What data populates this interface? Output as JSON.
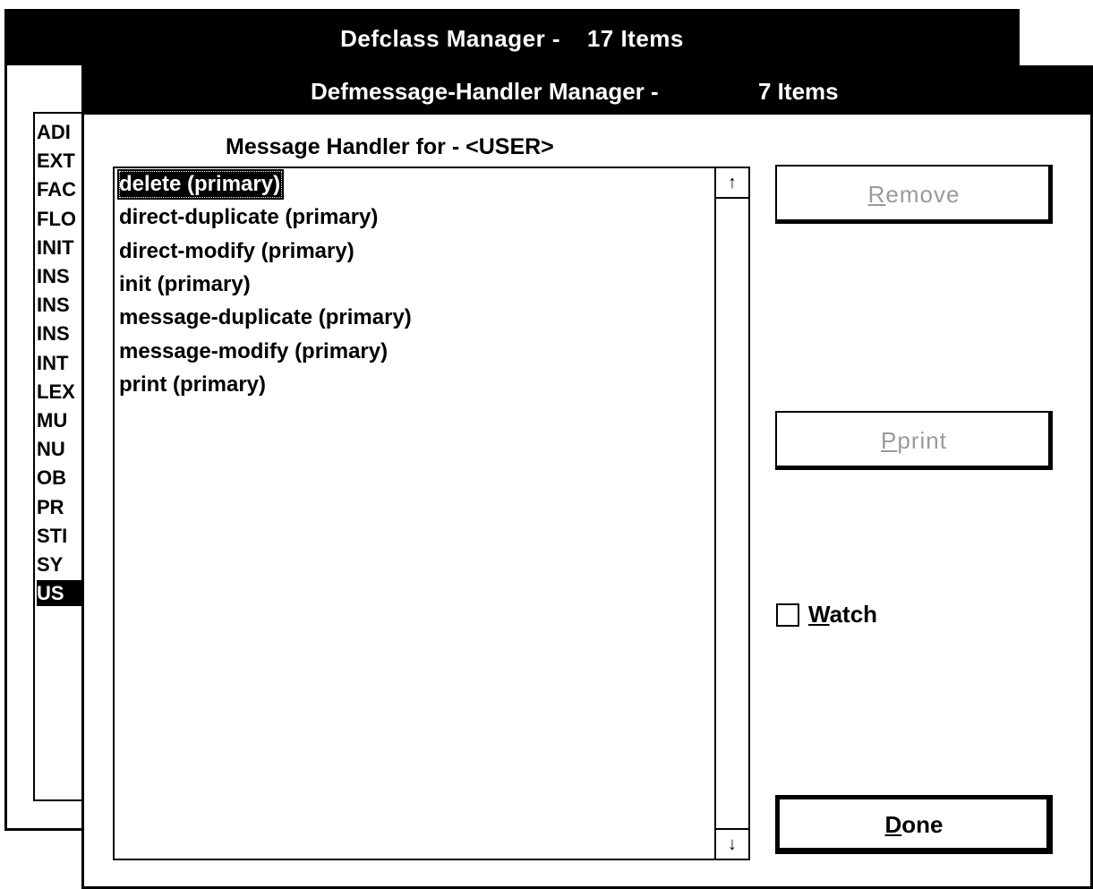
{
  "back_window": {
    "title": "Defclass Manager -",
    "count": "17 Items",
    "items": [
      {
        "label": "ADI",
        "selected": false
      },
      {
        "label": "EXT",
        "selected": false
      },
      {
        "label": "FAC",
        "selected": false
      },
      {
        "label": "FLO",
        "selected": false
      },
      {
        "label": "INIT",
        "selected": false
      },
      {
        "label": "INS",
        "selected": false
      },
      {
        "label": "INS",
        "selected": false
      },
      {
        "label": "INS",
        "selected": false
      },
      {
        "label": "INT",
        "selected": false
      },
      {
        "label": "LEX",
        "selected": false
      },
      {
        "label": "MU",
        "selected": false
      },
      {
        "label": "NU",
        "selected": false
      },
      {
        "label": "OB",
        "selected": false
      },
      {
        "label": "PR",
        "selected": false
      },
      {
        "label": "STI",
        "selected": false
      },
      {
        "label": "SY",
        "selected": false
      },
      {
        "label": "US",
        "selected": true
      }
    ]
  },
  "front_window": {
    "title": "Defmessage-Handler Manager -",
    "count": "7 Items",
    "subtitle": "Message Handler for - <USER>",
    "handlers": [
      {
        "label": "delete (primary)",
        "selected": true
      },
      {
        "label": "direct-duplicate (primary)",
        "selected": false
      },
      {
        "label": "direct-modify (primary)",
        "selected": false
      },
      {
        "label": "init (primary)",
        "selected": false
      },
      {
        "label": "message-duplicate (primary)",
        "selected": false
      },
      {
        "label": "message-modify (primary)",
        "selected": false
      },
      {
        "label": "print (primary)",
        "selected": false
      }
    ],
    "scroll_up_icon": "↑",
    "scroll_down_icon": "↓",
    "buttons": {
      "remove": {
        "mnemonic": "R",
        "rest": "emove",
        "enabled": false
      },
      "pprint": {
        "mnemonic": "P",
        "rest": "print",
        "enabled": false
      },
      "done": {
        "mnemonic": "D",
        "rest": "one",
        "enabled": true
      }
    },
    "watch": {
      "mnemonic": "W",
      "rest": "atch",
      "checked": false
    }
  }
}
